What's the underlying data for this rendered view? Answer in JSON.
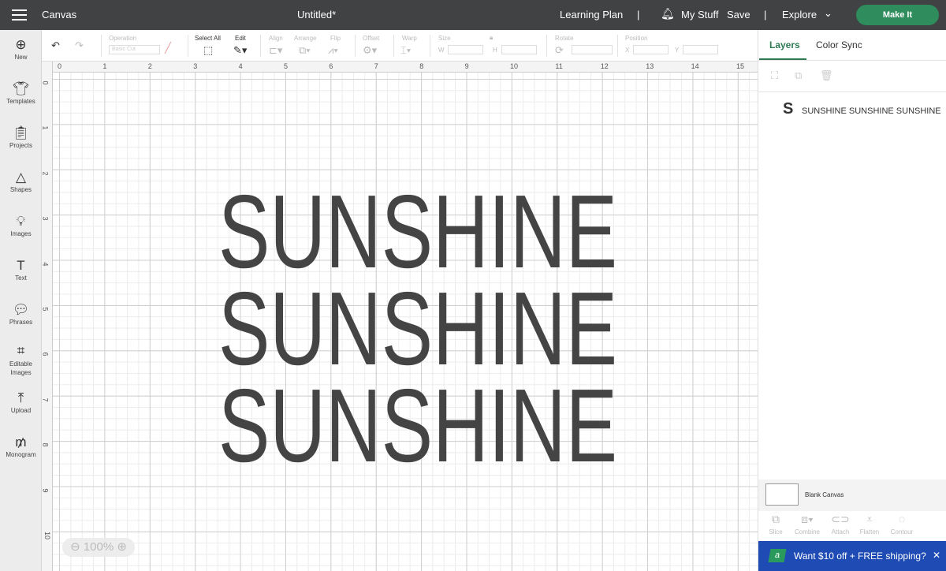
{
  "topbar": {
    "title": "Canvas",
    "doc": "Untitled*",
    "learning": "Learning Plan",
    "sep": "|",
    "mystuff": "My Stuff",
    "save": "Save",
    "explore": "Explore",
    "makeit": "Make It"
  },
  "sidebar": [
    "New",
    "Templates",
    "Projects",
    "Shapes",
    "Images",
    "Text",
    "Phrases",
    "Editable Images",
    "Upload",
    "Monogram"
  ],
  "toolbar": {
    "operation": "Operation",
    "operation_value": "Basic Cut",
    "select_all": "Select All",
    "edit": "Edit",
    "align": "Align",
    "arrange": "Arrange",
    "flip": "Flip",
    "offset": "Offset",
    "warp": "Warp",
    "size": "Size",
    "w": "W",
    "h": "H",
    "rotate": "Rotate",
    "position": "Position",
    "x": "X",
    "y": "Y"
  },
  "ruler": {
    "top": [
      "0",
      "1",
      "2",
      "3",
      "4",
      "5",
      "6",
      "7",
      "8",
      "9",
      "10",
      "11",
      "12",
      "13",
      "14",
      "15"
    ],
    "left": [
      "0",
      "1",
      "2",
      "3",
      "4",
      "5",
      "6",
      "7",
      "8",
      "9",
      "10"
    ]
  },
  "canvas_text": [
    "SUNSHINE",
    "SUNSHINE",
    "SUNSHINE"
  ],
  "text_color": "#444444",
  "zoom": "100%",
  "panel": {
    "tabs": [
      "Layers",
      "Color Sync"
    ],
    "layer_icon": "S",
    "layer_name": "SUNSHINE SUNSHINE SUNSHINE",
    "blank": "Blank Canvas",
    "tools": [
      "Slice",
      "Combine",
      "Attach",
      "Flatten",
      "Contour"
    ],
    "promo": "Want $10 off + FREE shipping?"
  },
  "colors": {
    "topbar": "#414244",
    "accent": "#2f8c5c",
    "promo": "#1f4bb4"
  }
}
